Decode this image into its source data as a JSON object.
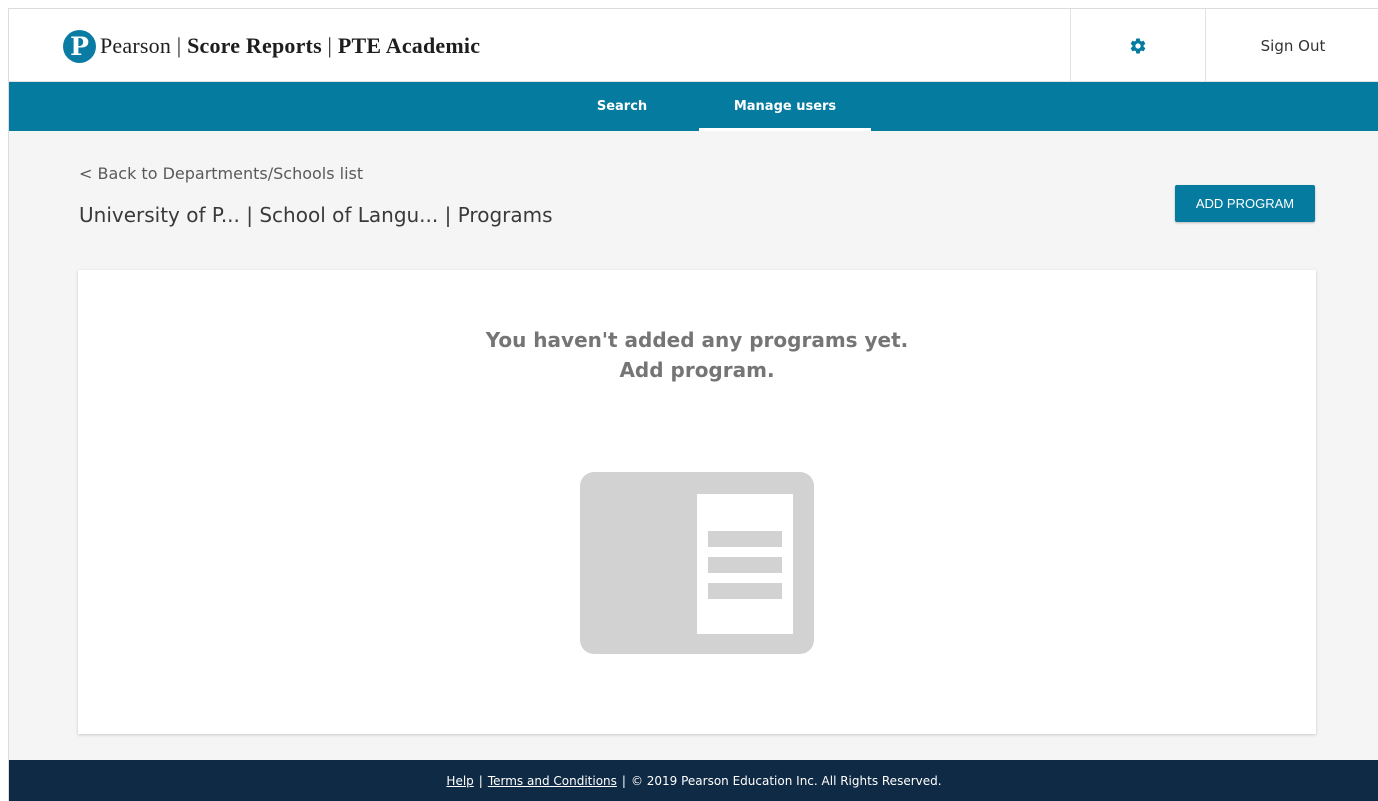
{
  "header": {
    "logo_letter": "P",
    "brand_name": "Pearson",
    "brand_sep": " | ",
    "product": "Score Reports",
    "product_sep": " | ",
    "exam": "PTE Academic",
    "settings_icon": "gear-icon",
    "sign_out": "Sign Out"
  },
  "nav": {
    "tabs": [
      {
        "label": "Search",
        "active": false
      },
      {
        "label": "Manage users",
        "active": true
      }
    ]
  },
  "main": {
    "back_link": "< Back to Departments/Schools list",
    "title": "University of P... | School of Langu... | Programs",
    "add_button": "ADD PROGRAM",
    "empty_line1": "You haven't added any programs yet.",
    "empty_line2": "Add program.",
    "empty_icon": "document-placeholder-icon"
  },
  "footer": {
    "help": "Help",
    "sep": "|",
    "terms": "Terms and Conditions",
    "copyright": "© 2019 Pearson Education Inc. All Rights Reserved."
  },
  "colors": {
    "accent": "#047b9f",
    "footer_bg": "#0f2a44",
    "page_bg": "#f5f5f5",
    "empty_text": "#757575",
    "illustration": "#d2d2d2"
  }
}
